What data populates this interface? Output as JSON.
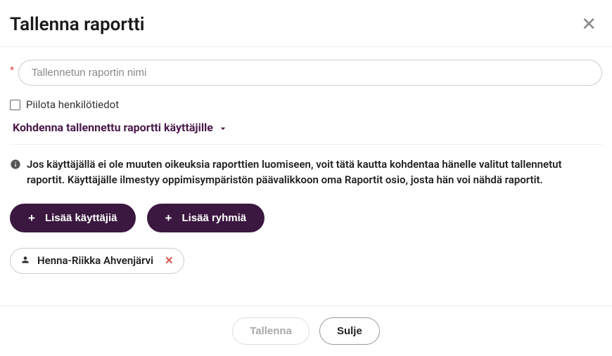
{
  "modal": {
    "title": "Tallenna raportti",
    "name_input": {
      "placeholder": "Tallennetun raportin nimi"
    },
    "hide_checkbox": {
      "label": "Piilota henkilötiedot"
    },
    "target_section": {
      "label": "Kohdenna tallennettu raportti käyttäjille"
    },
    "info_text": "Jos käyttäjällä ei ole muuten oikeuksia raporttien luomiseen, voit tätä kautta kohdentaa hänelle valitut tallennetut raportit. Käyttäjälle ilmestyy oppimisympäristön päävalikkoon oma Raportit osio, josta hän voi nähdä raportit.",
    "buttons": {
      "add_users": "Lisää käyttäjiä",
      "add_groups": "Lisää ryhmiä"
    },
    "selected_user": {
      "name": "Henna-Riikka Ahvenjärvi"
    },
    "footer": {
      "save": "Tallenna",
      "close": "Sulje"
    }
  }
}
